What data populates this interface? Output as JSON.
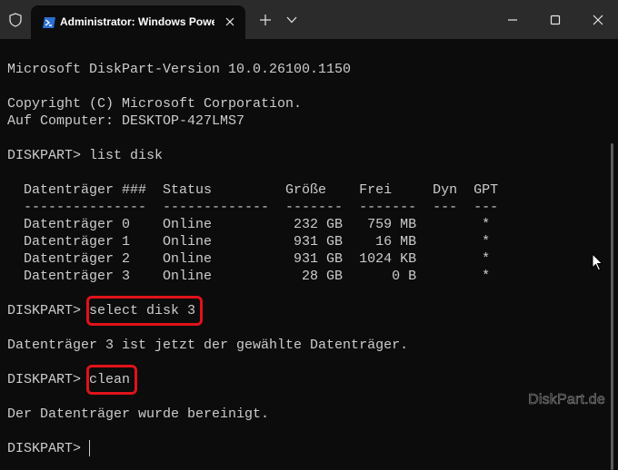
{
  "window": {
    "tab_title": "Administrator: Windows PowerShell",
    "icons": {
      "shield": "shield-icon",
      "app": "powershell-icon",
      "close_tab": "close-icon",
      "new_tab": "plus-icon",
      "dropdown": "chevron-down-icon",
      "minimize": "minimize-icon",
      "maximize": "maximize-icon",
      "close": "close-icon"
    }
  },
  "terminal": {
    "lines": [
      "Microsoft DiskPart-Version 10.0.26100.1150",
      "",
      "Copyright (C) Microsoft Corporation.",
      "Auf Computer: DESKTOP-427LMS7",
      "",
      "DISKPART> list disk",
      "",
      "  Datenträger ###  Status         Größe    Frei     Dyn  GPT",
      "  ---------------  -------------  -------  -------  ---  ---",
      "  Datenträger 0    Online          232 GB   759 MB        *",
      "  Datenträger 1    Online          931 GB    16 MB        *",
      "  Datenträger 2    Online          931 GB  1024 KB        *",
      "  Datenträger 3    Online           28 GB      0 B        *",
      "",
      "DISKPART> select disk 3",
      "",
      "Datenträger 3 ist jetzt der gewählte Datenträger.",
      "",
      "DISKPART> clean",
      "",
      "Der Datenträger wurde bereinigt.",
      "",
      "DISKPART> "
    ],
    "highlight_color": "#e0121a",
    "text_color": "#cccccc",
    "background_color": "#0c0c0c"
  },
  "watermark": "DiskPart.de"
}
